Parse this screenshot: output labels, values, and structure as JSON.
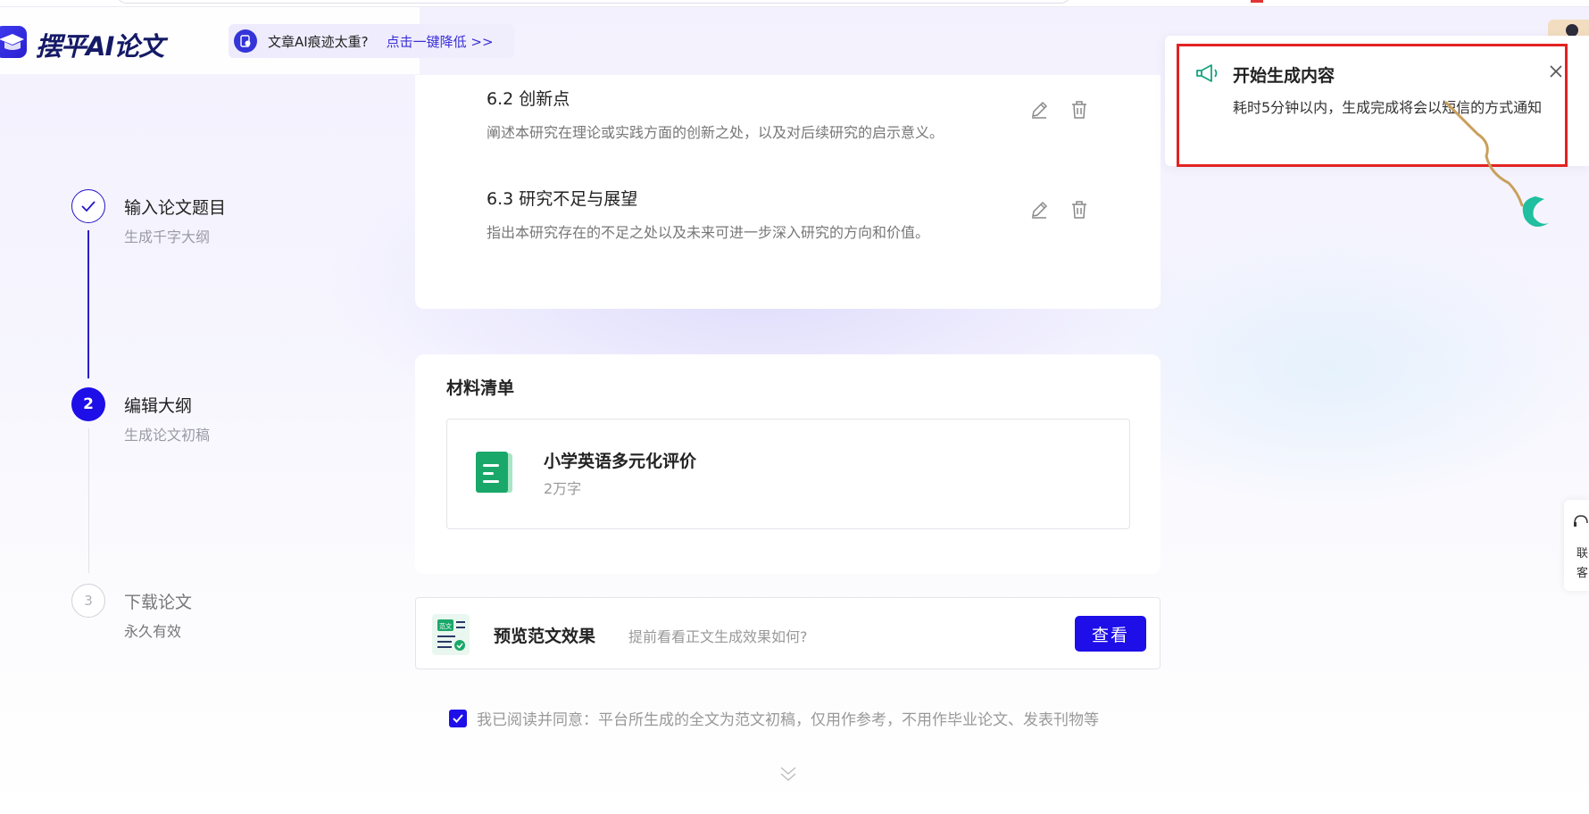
{
  "header": {
    "logo_text": "摆平AI论文",
    "notice_text": "文章AI痕迹太重?",
    "notice_link": "点击一键降低 >>"
  },
  "steps": [
    {
      "num": "",
      "title": "输入论文题目",
      "sub": "生成千字大纲",
      "state": "done"
    },
    {
      "num": "2",
      "title": "编辑大纲",
      "sub": "生成论文初稿",
      "state": "active"
    },
    {
      "num": "3",
      "title": "下载论文",
      "sub": "永久有效",
      "state": "pending"
    }
  ],
  "outline": [
    {
      "title": "6.2 创新点",
      "desc": "阐述本研究在理论或实践方面的创新之处，以及对后续研究的启示意义。"
    },
    {
      "title": "6.3 研究不足与展望",
      "desc": "指出本研究存在的不足之处以及未来可进一步深入研究的方向和价值。"
    }
  ],
  "materials": {
    "title": "材料清单",
    "items": [
      {
        "name": "小学英语多元化评价",
        "size": "2万字"
      }
    ]
  },
  "preview": {
    "icon_label": "范文",
    "title": "预览范文效果",
    "desc": "提前看看正文生成效果如何?",
    "button": "查看"
  },
  "agreement": {
    "checked": true,
    "text": "我已阅读并同意：平台所生成的全文为范文初稿，仅用作参考，不用作毕业论文、发表刊物等"
  },
  "toast": {
    "title": "开始生成内容",
    "body": "耗时5分钟以内，生成完成将会以短信的方式通知"
  },
  "side_contact": {
    "text": "联客"
  },
  "colors": {
    "primary": "#1e0ee8",
    "highlight_border": "#e32222",
    "toast_icon": "#14a37f",
    "doc_icon": "#1aa86a"
  }
}
